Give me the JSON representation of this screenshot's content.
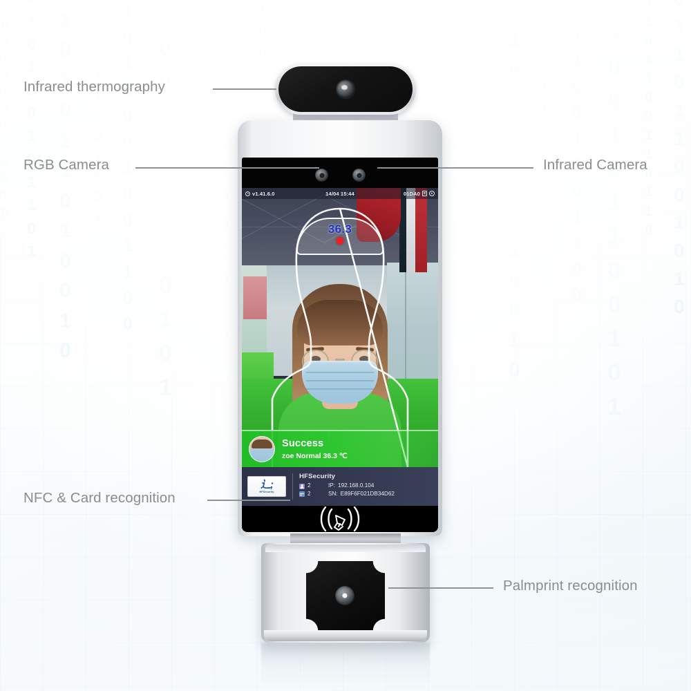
{
  "callouts": [
    {
      "id": "infrared-thermography",
      "label": "Infrared thermography"
    },
    {
      "id": "rgb-camera",
      "label": "RGB Camera"
    },
    {
      "id": "infrared-camera",
      "label": "Infrared Camera"
    },
    {
      "id": "nfc-card-recognition",
      "label": "NFC & Card recognition"
    },
    {
      "id": "palmprint-recognition",
      "label": "Palmprint recognition"
    }
  ],
  "device": {
    "screen": {
      "status_bar": {
        "firmware": "v1.41.6.0",
        "datetime": "14/04 15:44",
        "device_code": "01DA0",
        "icons": [
          "info-icon",
          "sim-icon",
          "gear-icon"
        ]
      },
      "detection": {
        "temperature": "36.3",
        "temperature_color": "#1f35c4",
        "marker_color": "#f01f1f"
      },
      "result_banner": {
        "title": "Success",
        "detail": "zoe Normal 36.3 ℃",
        "background_color": "#22be28"
      },
      "info_panel": {
        "company": "HFSecurity",
        "face_count": "2",
        "card_count": "2",
        "ip_label": "IP:",
        "ip_value": "192.168.0.104",
        "sn_label": "SN:",
        "sn_value": "E89F6F021DB34D62"
      },
      "nfc_area": {
        "icon": "nfc-card-tap-icon"
      }
    }
  },
  "theme": {
    "label_color": "#8a8d8f",
    "leader_color": "#8f9294",
    "binary_color": "#bfe2f2",
    "background": "#eaf4f9"
  },
  "background": {
    "binary_columns": [
      "1 0 0 1 0 1 0 1 1 0 0 1 0",
      "0 1 1 0 1 0 0 1 0 1 1 0 1",
      "1 1 0 1 0 1 1 0 1 0 0 1 0",
      "0 0 1 0 1 1 0 0 1 1 0 1 1",
      "1 0 1 1 0 0 1 0 0 1 1 0 0",
      "0 1 0 0 1 0 1 1 0 0 1 0 1",
      "1 1 0 1 1 0 0 1 1 0 1 1 0",
      "0 0 1 1 0 1 1 0 0 1 0 1 0",
      "1 0 0 1 1 1 0 1 0 1 1 0 1",
      "0 1 1 0 0 1 0 0 1 1 0 0 1",
      "1 0 1 0 1 0 1 1 0 0 1 1 0",
      "0 1 0 1 1 0 0 1 1 0 0 1 1",
      "1 1 1 0 0 1 1 0 1 1 0 0 1",
      "0 0 1 1 1 0 1 0 0 1 1 1 0"
    ]
  }
}
